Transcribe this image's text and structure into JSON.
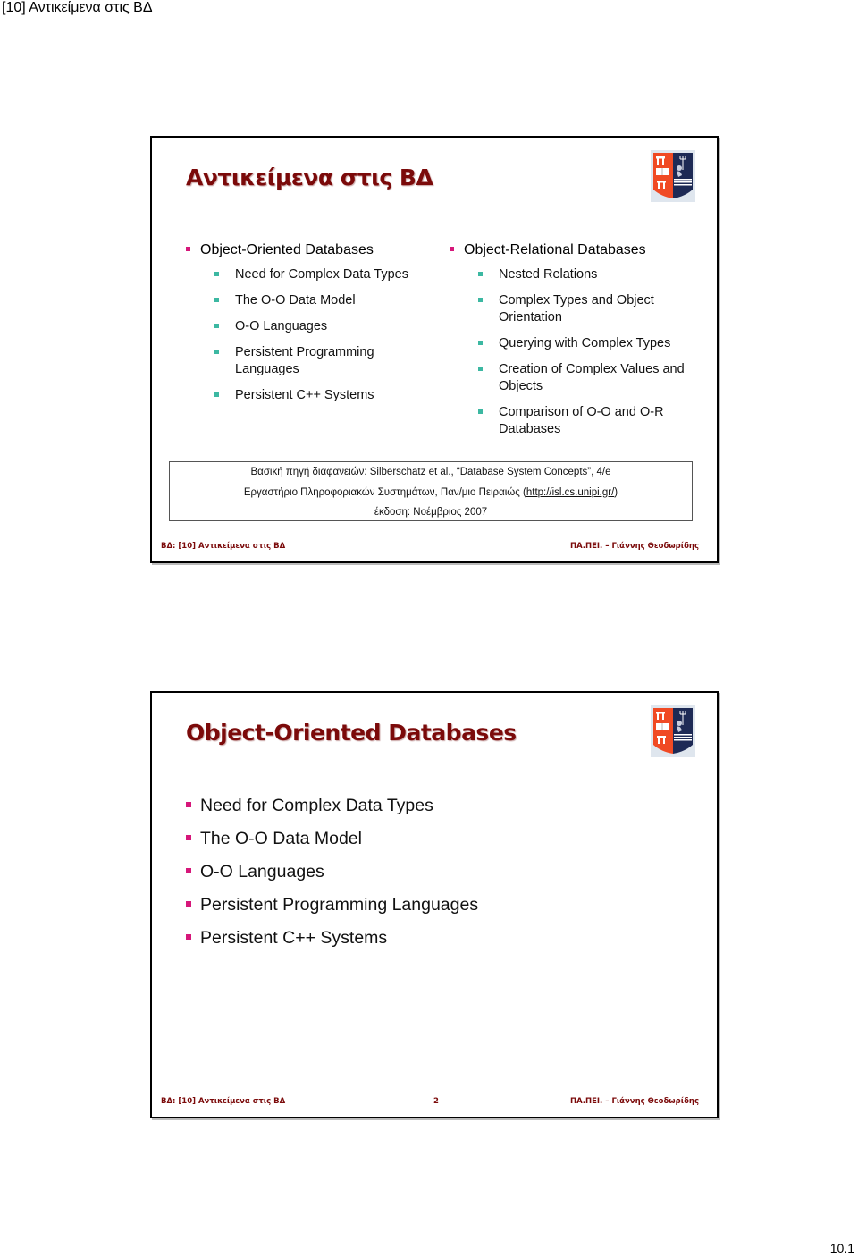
{
  "document": {
    "header": "[10] Αντικείμενα στις ΒΔ",
    "page_number": "10.1"
  },
  "slides": [
    {
      "title": "Αντικείμενα στις ΒΔ",
      "columns": [
        {
          "heading": "Object-Oriented Databases",
          "items": [
            "Need for Complex Data Types",
            "The O-O Data Model",
            "O-O Languages",
            "Persistent Programming Languages",
            "Persistent C++ Systems"
          ]
        },
        {
          "heading": "Object-Relational Databases",
          "items": [
            "Nested Relations",
            "Complex Types and Object Orientation",
            "Querying with Complex Types",
            "Creation of Complex Values and Objects",
            "Comparison of O-O and O-R Databases"
          ]
        }
      ],
      "source": {
        "line1": "Βασική πηγή διαφανειών: Silberschatz et al., “Database System Concepts”, 4/e",
        "line2_prefix": "Εργαστήριο Πληροφοριακών Συστημάτων, Παν/μιο Πειραιώς (",
        "line2_link": "http://isl.cs.unipi.gr/",
        "line2_suffix": ")",
        "line3": "έκδοση: Νοέμβριος 2007"
      },
      "footer": {
        "left": "ΒΔ: [10] Αντικείμενα στις ΒΔ",
        "center": "",
        "right": "ΠΑ.ΠΕΙ. – Γιάννης Θεοδωρίδης"
      }
    },
    {
      "title": "Object-Oriented Databases",
      "items": [
        "Need for Complex Data Types",
        "The O-O Data Model",
        "O-O Languages",
        "Persistent Programming Languages",
        "Persistent C++ Systems"
      ],
      "footer": {
        "left": "ΒΔ: [10] Αντικείμενα στις ΒΔ",
        "center": "2",
        "right": "ΠΑ.ΠΕΙ. – Γιάννης Θεοδωρίδης"
      }
    }
  ],
  "colors": {
    "title": "#7b0a0a",
    "bullet_level1": "#d6177a",
    "bullet_level2": "#3cb8a2"
  },
  "icons": {
    "logo": "university-of-piraeus-crest-icon"
  }
}
